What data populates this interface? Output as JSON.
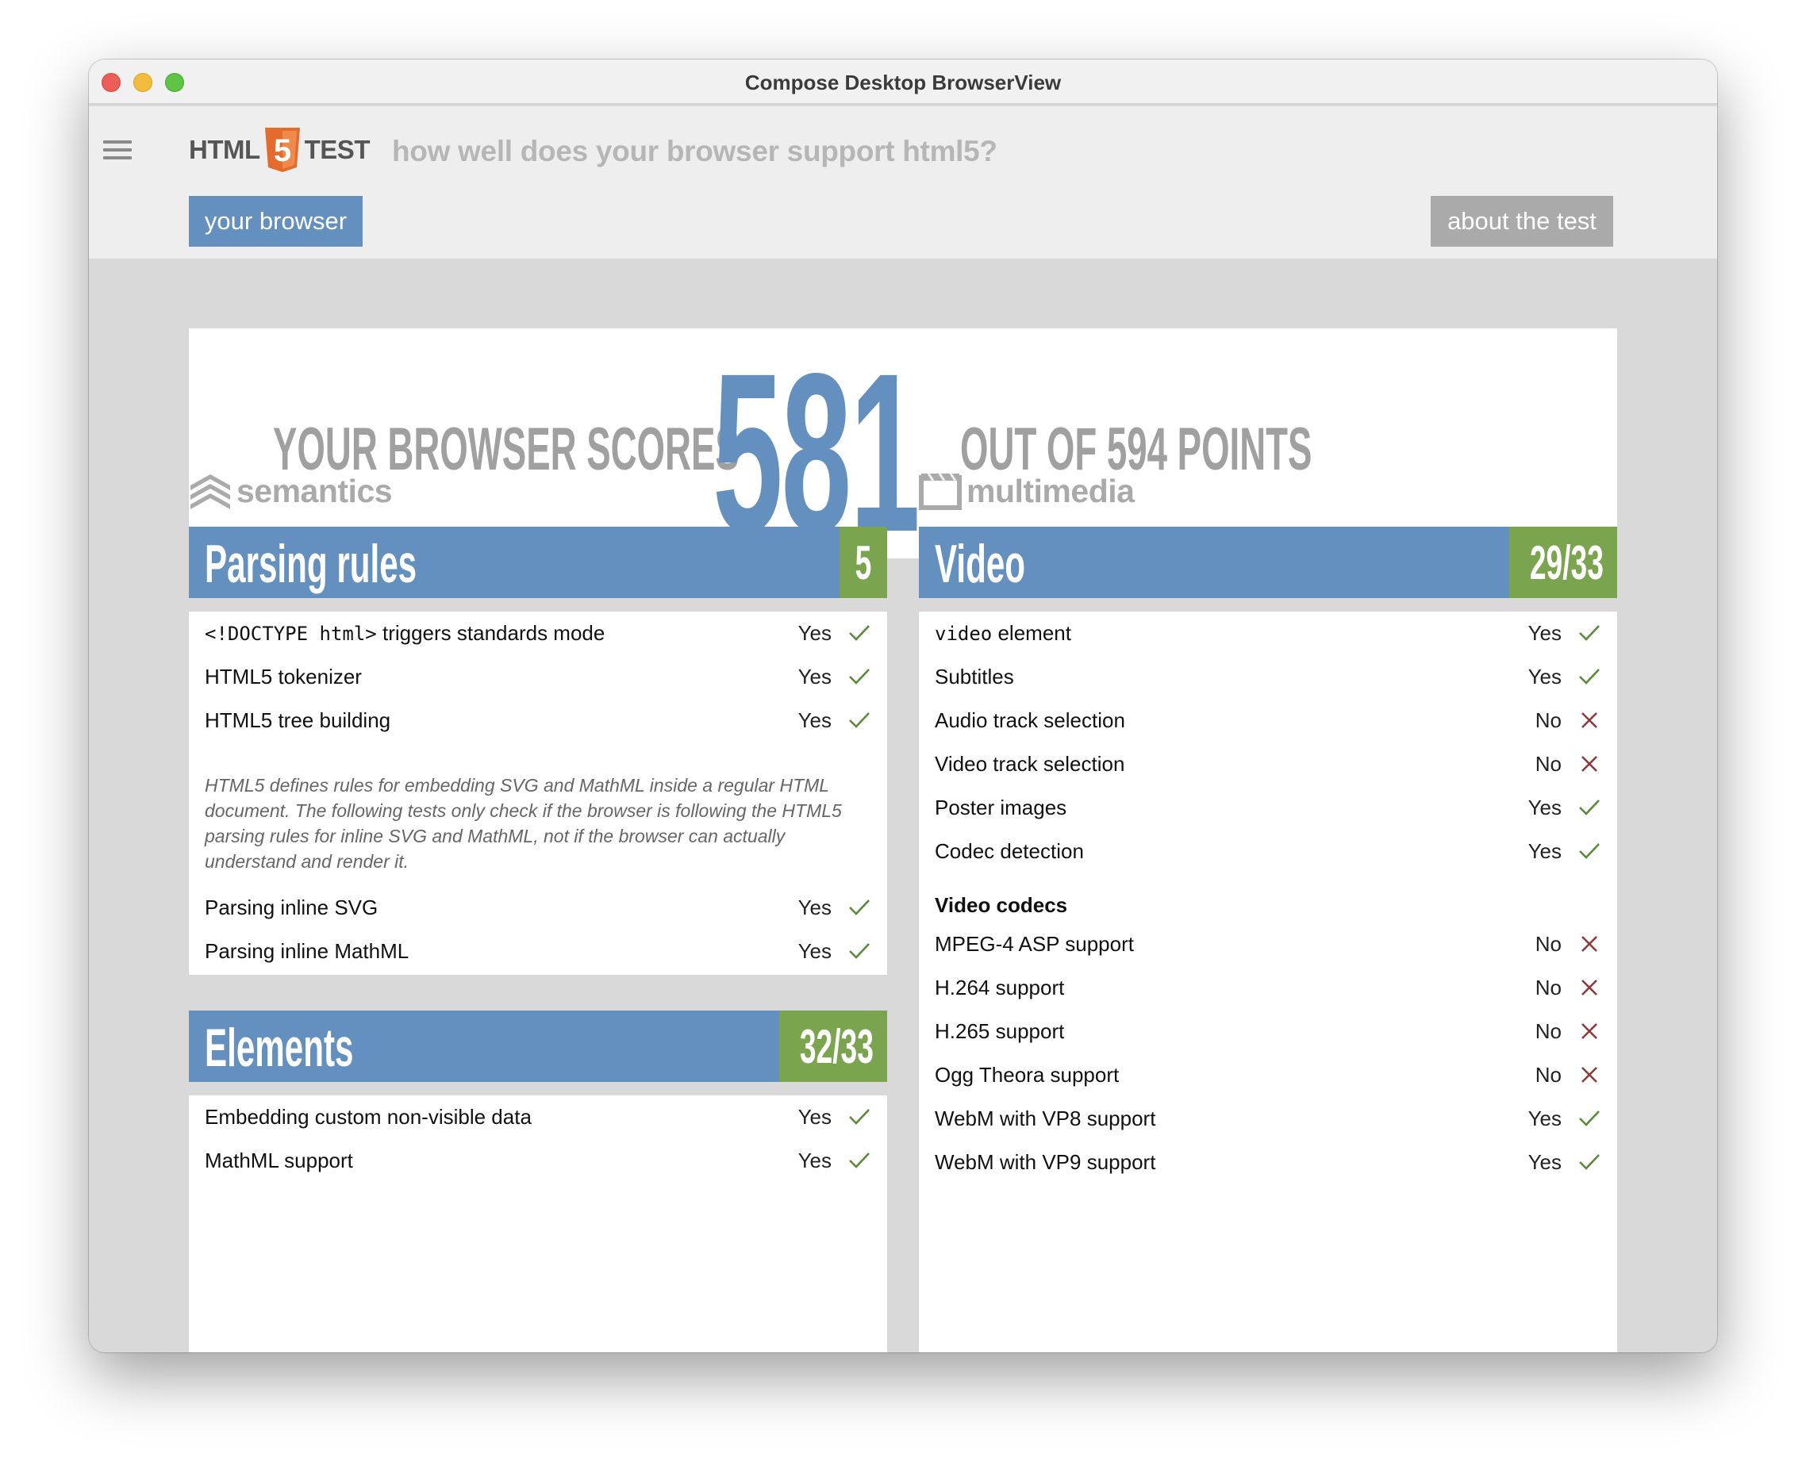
{
  "window": {
    "title": "Compose Desktop BrowserView"
  },
  "header": {
    "logo_left": "HTML",
    "logo_number": "5",
    "logo_right": "TEST",
    "tagline": "how well does your browser support html5?",
    "your_browser": "your browser",
    "about": "about the test"
  },
  "score": {
    "prefix": "YOUR BROWSER SCORES",
    "value": "581",
    "suffix": "OUT OF 594 POINTS"
  },
  "categories": {
    "left": "semantics",
    "right": "multimedia"
  },
  "sections": {
    "parsing": {
      "title": "Parsing rules",
      "score": "5",
      "items": [
        {
          "code": "<!DOCTYPE html>",
          "label": " triggers standards mode",
          "result": "Yes"
        },
        {
          "label": "HTML5 tokenizer",
          "result": "Yes"
        },
        {
          "label": "HTML5 tree building",
          "result": "Yes"
        }
      ],
      "note": "HTML5 defines rules for embedding SVG and MathML inside a regular HTML document. The following tests only check if the browser is following the HTML5 parsing rules for inline SVG and MathML, not if the browser can actually understand and render it.",
      "items2": [
        {
          "label": "Parsing inline SVG",
          "result": "Yes"
        },
        {
          "label": "Parsing inline MathML",
          "result": "Yes"
        }
      ]
    },
    "elements": {
      "title": "Elements",
      "score": "32/33",
      "items": [
        {
          "label": "Embedding custom non-visible data",
          "result": "Yes"
        },
        {
          "label": "MathML support",
          "result": "Yes"
        }
      ]
    },
    "video": {
      "title": "Video",
      "score": "29/33",
      "items": [
        {
          "code": "video",
          "label": " element",
          "result": "Yes"
        },
        {
          "label": "Subtitles",
          "result": "Yes"
        },
        {
          "label": "Audio track selection",
          "result": "No"
        },
        {
          "label": "Video track selection",
          "result": "No"
        },
        {
          "label": "Poster images",
          "result": "Yes"
        },
        {
          "label": "Codec detection",
          "result": "Yes"
        }
      ],
      "codecs_heading": "Video codecs",
      "codecs": [
        {
          "label": "MPEG-4 ASP support",
          "result": "No"
        },
        {
          "label": "H.264 support",
          "result": "No"
        },
        {
          "label": "H.265 support",
          "result": "No"
        },
        {
          "label": "Ogg Theora support",
          "result": "No"
        },
        {
          "label": "WebM with VP8 support",
          "result": "Yes"
        },
        {
          "label": "WebM with VP9 support",
          "result": "Yes"
        }
      ]
    }
  },
  "colors": {
    "accent_blue": "#6490bf",
    "score_green": "#7ba44e",
    "yes_mark": "#5a8a3a",
    "no_mark": "#8b3a3a"
  },
  "icons": {
    "yes": "check-icon",
    "no": "cross-icon",
    "semantics": "layers-icon",
    "multimedia": "clapperboard-icon"
  }
}
